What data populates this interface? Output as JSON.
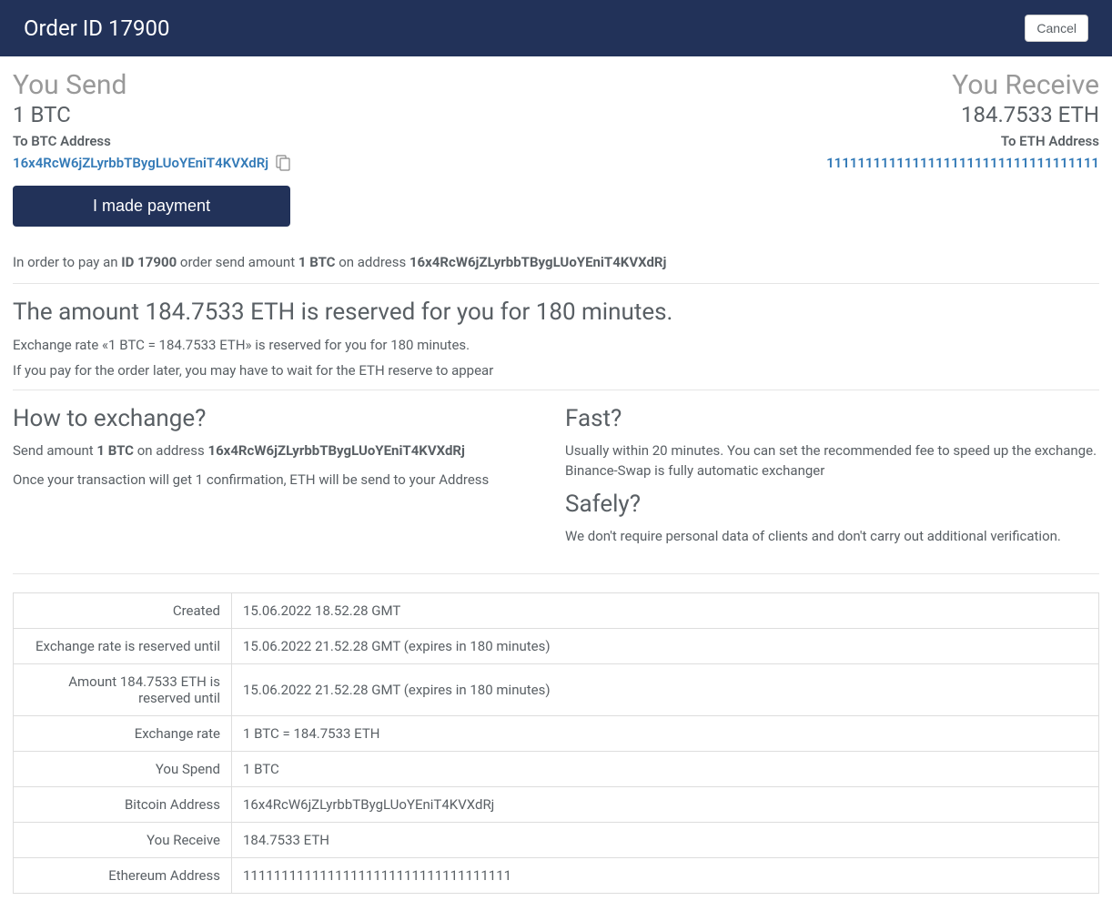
{
  "header": {
    "title": "Order ID 17900",
    "cancel_label": "Cancel"
  },
  "send": {
    "title": "You Send",
    "amount": "1 BTC",
    "addr_label": "To BTC Address",
    "address": "16x4RcW6jZLyrbbTBygLUoYEniT4KVXdRj",
    "payment_button": "I made payment"
  },
  "receive": {
    "title": "You Receive",
    "amount": "184.7533 ETH",
    "addr_label": "To ETH Address",
    "address": "11111111111111111111111111111111111"
  },
  "instruction": {
    "prefix": "In order to pay an ",
    "order_id": "ID 17900",
    "mid1": " order send amount ",
    "amount": "1 BTC",
    "mid2": " on address ",
    "address": "16x4RcW6jZLyrbbTBygLUoYEniT4KVXdRj"
  },
  "reserve": {
    "title": "The amount 184.7533 ETH is reserved for you for 180 minutes.",
    "p1": "Exchange rate «1 BTC = 184.7533 ETH» is reserved for you for 180 minutes.",
    "p2": "If you pay for the order later, you may have to wait for the ETH reserve to appear"
  },
  "howto": {
    "title": "How to exchange?",
    "p1_prefix": "Send amount ",
    "p1_amount": "1 BTC",
    "p1_mid": " on address ",
    "p1_address": "16x4RcW6jZLyrbbTBygLUoYEniT4KVXdRj",
    "p2": "Once your transaction will get 1 confirmation, ETH will be send to your Address"
  },
  "fast": {
    "title": "Fast?",
    "text": "Usually within 20 minutes. You can set the recommended fee to speed up the exchange. Binance-Swap is fully automatic exchanger"
  },
  "safely": {
    "title": "Safely?",
    "text": "We don't require personal data of clients and don't carry out additional verification."
  },
  "details": [
    {
      "label": "Created",
      "value": "15.06.2022 18.52.28 GMT"
    },
    {
      "label": "Exchange rate is reserved until",
      "value": "15.06.2022 21.52.28 GMT (expires in 180 minutes)"
    },
    {
      "label": "Amount 184.7533 ETH is reserved until",
      "value": "15.06.2022 21.52.28 GMT (expires in 180 minutes)"
    },
    {
      "label": "Exchange rate",
      "value": "1 BTC = 184.7533 ETH"
    },
    {
      "label": "You Spend",
      "value": "1 BTC"
    },
    {
      "label": "Bitcoin Address",
      "value": "16x4RcW6jZLyrbbTBygLUoYEniT4KVXdRj"
    },
    {
      "label": "You Receive",
      "value": "184.7533 ETH"
    },
    {
      "label": "Ethereum Address",
      "value": "11111111111111111111111111111111111"
    }
  ]
}
